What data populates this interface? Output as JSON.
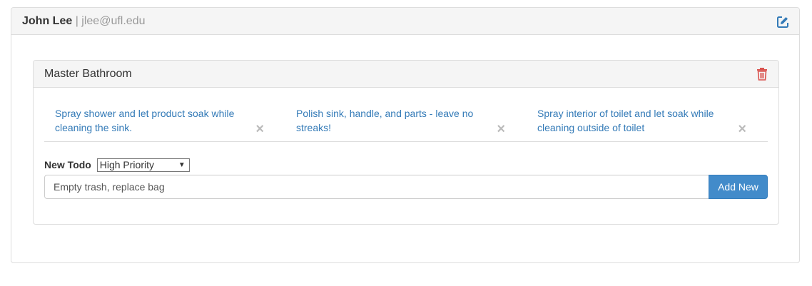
{
  "user": {
    "name": "John Lee",
    "separator": "|",
    "email": "jlee@ufl.edu"
  },
  "room": {
    "title": "Master Bathroom",
    "todos": [
      {
        "text": "Spray shower and let product soak while cleaning the sink.",
        "close": "×"
      },
      {
        "text": "Polish sink, handle, and parts - leave no streaks!",
        "close": "×"
      },
      {
        "text": "Spray interior of toilet and let soak while cleaning outside of toilet",
        "close": "×"
      }
    ],
    "new_todo": {
      "label": "New Todo",
      "priority_selected": "High Priority",
      "input_value": "Empty trash, replace bag",
      "add_label": "Add New"
    }
  },
  "colors": {
    "link": "#337ab7",
    "primary_button": "#428bca",
    "trash": "#d9534f",
    "edit": "#337ab7"
  },
  "icons": {
    "edit": "edit-icon",
    "trash": "trash-icon",
    "close": "close-icon"
  }
}
